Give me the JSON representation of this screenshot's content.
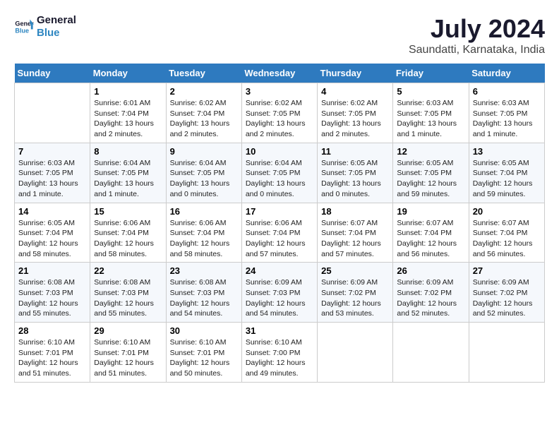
{
  "logo": {
    "line1": "General",
    "line2": "Blue"
  },
  "title": "July 2024",
  "subtitle": "Saundatti, Karnataka, India",
  "days_of_week": [
    "Sunday",
    "Monday",
    "Tuesday",
    "Wednesday",
    "Thursday",
    "Friday",
    "Saturday"
  ],
  "weeks": [
    [
      {
        "day": "",
        "sunrise": "",
        "sunset": "",
        "daylight": ""
      },
      {
        "day": "1",
        "sunrise": "6:01 AM",
        "sunset": "7:04 PM",
        "daylight": "13 hours and 2 minutes."
      },
      {
        "day": "2",
        "sunrise": "6:02 AM",
        "sunset": "7:04 PM",
        "daylight": "13 hours and 2 minutes."
      },
      {
        "day": "3",
        "sunrise": "6:02 AM",
        "sunset": "7:05 PM",
        "daylight": "13 hours and 2 minutes."
      },
      {
        "day": "4",
        "sunrise": "6:02 AM",
        "sunset": "7:05 PM",
        "daylight": "13 hours and 2 minutes."
      },
      {
        "day": "5",
        "sunrise": "6:03 AM",
        "sunset": "7:05 PM",
        "daylight": "13 hours and 1 minute."
      },
      {
        "day": "6",
        "sunrise": "6:03 AM",
        "sunset": "7:05 PM",
        "daylight": "13 hours and 1 minute."
      }
    ],
    [
      {
        "day": "7",
        "sunrise": "6:03 AM",
        "sunset": "7:05 PM",
        "daylight": "13 hours and 1 minute."
      },
      {
        "day": "8",
        "sunrise": "6:04 AM",
        "sunset": "7:05 PM",
        "daylight": "13 hours and 1 minute."
      },
      {
        "day": "9",
        "sunrise": "6:04 AM",
        "sunset": "7:05 PM",
        "daylight": "13 hours and 0 minutes."
      },
      {
        "day": "10",
        "sunrise": "6:04 AM",
        "sunset": "7:05 PM",
        "daylight": "13 hours and 0 minutes."
      },
      {
        "day": "11",
        "sunrise": "6:05 AM",
        "sunset": "7:05 PM",
        "daylight": "13 hours and 0 minutes."
      },
      {
        "day": "12",
        "sunrise": "6:05 AM",
        "sunset": "7:05 PM",
        "daylight": "12 hours and 59 minutes."
      },
      {
        "day": "13",
        "sunrise": "6:05 AM",
        "sunset": "7:04 PM",
        "daylight": "12 hours and 59 minutes."
      }
    ],
    [
      {
        "day": "14",
        "sunrise": "6:05 AM",
        "sunset": "7:04 PM",
        "daylight": "12 hours and 58 minutes."
      },
      {
        "day": "15",
        "sunrise": "6:06 AM",
        "sunset": "7:04 PM",
        "daylight": "12 hours and 58 minutes."
      },
      {
        "day": "16",
        "sunrise": "6:06 AM",
        "sunset": "7:04 PM",
        "daylight": "12 hours and 58 minutes."
      },
      {
        "day": "17",
        "sunrise": "6:06 AM",
        "sunset": "7:04 PM",
        "daylight": "12 hours and 57 minutes."
      },
      {
        "day": "18",
        "sunrise": "6:07 AM",
        "sunset": "7:04 PM",
        "daylight": "12 hours and 57 minutes."
      },
      {
        "day": "19",
        "sunrise": "6:07 AM",
        "sunset": "7:04 PM",
        "daylight": "12 hours and 56 minutes."
      },
      {
        "day": "20",
        "sunrise": "6:07 AM",
        "sunset": "7:04 PM",
        "daylight": "12 hours and 56 minutes."
      }
    ],
    [
      {
        "day": "21",
        "sunrise": "6:08 AM",
        "sunset": "7:03 PM",
        "daylight": "12 hours and 55 minutes."
      },
      {
        "day": "22",
        "sunrise": "6:08 AM",
        "sunset": "7:03 PM",
        "daylight": "12 hours and 55 minutes."
      },
      {
        "day": "23",
        "sunrise": "6:08 AM",
        "sunset": "7:03 PM",
        "daylight": "12 hours and 54 minutes."
      },
      {
        "day": "24",
        "sunrise": "6:09 AM",
        "sunset": "7:03 PM",
        "daylight": "12 hours and 54 minutes."
      },
      {
        "day": "25",
        "sunrise": "6:09 AM",
        "sunset": "7:02 PM",
        "daylight": "12 hours and 53 minutes."
      },
      {
        "day": "26",
        "sunrise": "6:09 AM",
        "sunset": "7:02 PM",
        "daylight": "12 hours and 52 minutes."
      },
      {
        "day": "27",
        "sunrise": "6:09 AM",
        "sunset": "7:02 PM",
        "daylight": "12 hours and 52 minutes."
      }
    ],
    [
      {
        "day": "28",
        "sunrise": "6:10 AM",
        "sunset": "7:01 PM",
        "daylight": "12 hours and 51 minutes."
      },
      {
        "day": "29",
        "sunrise": "6:10 AM",
        "sunset": "7:01 PM",
        "daylight": "12 hours and 51 minutes."
      },
      {
        "day": "30",
        "sunrise": "6:10 AM",
        "sunset": "7:01 PM",
        "daylight": "12 hours and 50 minutes."
      },
      {
        "day": "31",
        "sunrise": "6:10 AM",
        "sunset": "7:00 PM",
        "daylight": "12 hours and 49 minutes."
      },
      {
        "day": "",
        "sunrise": "",
        "sunset": "",
        "daylight": ""
      },
      {
        "day": "",
        "sunrise": "",
        "sunset": "",
        "daylight": ""
      },
      {
        "day": "",
        "sunrise": "",
        "sunset": "",
        "daylight": ""
      }
    ]
  ],
  "labels": {
    "sunrise_prefix": "Sunrise: ",
    "sunset_prefix": "Sunset: ",
    "daylight_prefix": "Daylight: "
  }
}
